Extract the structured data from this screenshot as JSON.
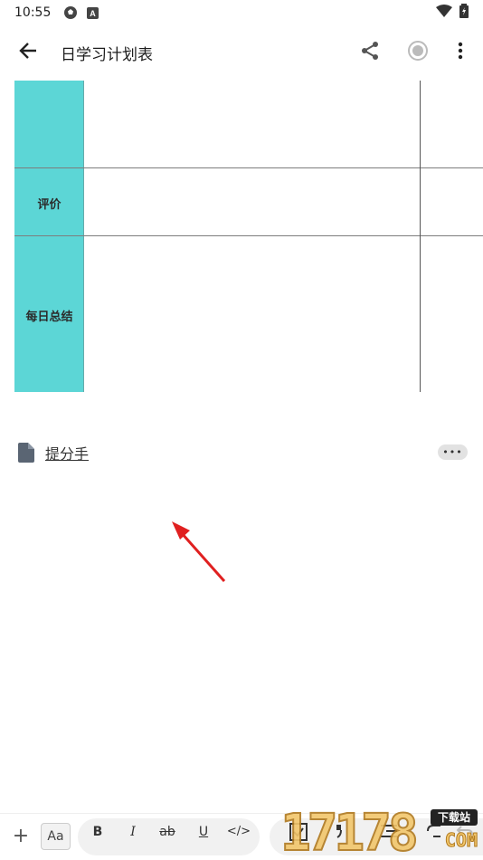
{
  "status_bar": {
    "time": "10:55",
    "icons": [
      "soccer-ball-icon",
      "a-badge-icon",
      "wifi-icon",
      "battery-charging-icon"
    ]
  },
  "app_bar": {
    "back_icon": "arrow-left-icon",
    "title": "日学习计划表",
    "actions": [
      "share-icon",
      "record-icon",
      "more-vert-icon"
    ]
  },
  "table": {
    "rows": [
      {
        "label": ""
      },
      {
        "label": "评价"
      },
      {
        "label": "每日总结"
      }
    ],
    "header_color": "#5cd6d6"
  },
  "attachment": {
    "icon": "file-icon",
    "name": "提分手",
    "more_label": "•••"
  },
  "annotation": {
    "type": "red-arrow",
    "color": "#e02020"
  },
  "toolbar": {
    "add_label": "+",
    "text_style_label": "Aa",
    "format_buttons": [
      "B",
      "I",
      "ab",
      "U",
      "</>"
    ],
    "extra_icons": [
      "checkbox-icon",
      "quote-icon",
      "list-icon",
      "link-icon",
      "undo-icon"
    ]
  },
  "watermark": {
    "digits": "17178",
    "tag": "下载站",
    "suffix": "COM"
  }
}
